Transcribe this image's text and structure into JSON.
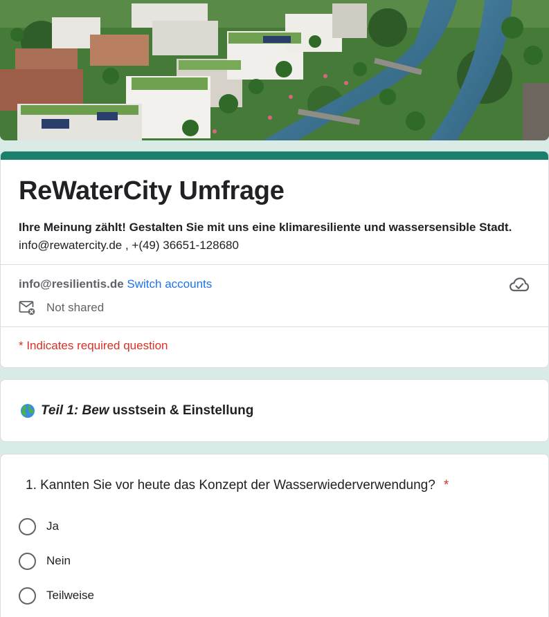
{
  "form": {
    "title": "ReWaterCity Umfrage",
    "description": "Ihre Meinung zählt! Gestalten Sie mit uns eine klimaresiliente und wassersensible Stadt.",
    "contact": "info@rewatercity.de ,  +(49) 36651-128680",
    "accent_color": "#1a7f6d",
    "background_color": "#d9ebe7"
  },
  "account": {
    "email": "info@resilientis.de",
    "switch_label": "Switch accounts",
    "not_shared_label": "Not shared",
    "cloud_icon": "cloud-check-icon",
    "mail_icon": "mail-not-shared-icon"
  },
  "required_note": "* Indicates required question",
  "section": {
    "icon": "globe-icon",
    "title_italic": "Teil 1: Bew",
    "title_rest": "usstsein & Einstellung"
  },
  "question": {
    "text": "1. Kannten Sie vor heute das Konzept der Wasserwiederverwendung?",
    "required_mark": "*",
    "options": [
      {
        "label": "Ja"
      },
      {
        "label": "Nein"
      },
      {
        "label": "Teilweise"
      }
    ]
  }
}
